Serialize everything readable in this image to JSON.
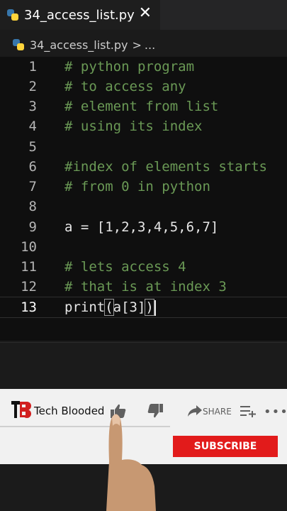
{
  "tab": {
    "title": "34_access_list.py",
    "close": "✕"
  },
  "breadcrumb": {
    "file": "34_access_list.py",
    "separator": ">",
    "more": "..."
  },
  "editor": {
    "lines": [
      {
        "num": "1",
        "text": "# python program"
      },
      {
        "num": "2",
        "text": "# to access any"
      },
      {
        "num": "3",
        "text": "# element from list"
      },
      {
        "num": "4",
        "text": "# using its index"
      },
      {
        "num": "5",
        "text": ""
      },
      {
        "num": "6",
        "text": "#index of elements starts"
      },
      {
        "num": "7",
        "text": "# from 0 in python"
      },
      {
        "num": "8",
        "text": ""
      },
      {
        "num": "9",
        "text": "a = [1,2,3,4,5,6,7]"
      },
      {
        "num": "10",
        "text": ""
      },
      {
        "num": "11",
        "text": "# lets access 4"
      },
      {
        "num": "12",
        "text": "# that is at index 3"
      },
      {
        "num": "13",
        "pre": "print",
        "open": "(",
        "mid": "a[3]",
        "close": ")"
      }
    ]
  },
  "youtube": {
    "channel": "Tech Blooded",
    "share": "SHARE",
    "subscribe": "SUBSCRIBE",
    "more": "•••"
  },
  "colors": {
    "comment": "#6a9955",
    "subscribe": "#e21b1b"
  }
}
